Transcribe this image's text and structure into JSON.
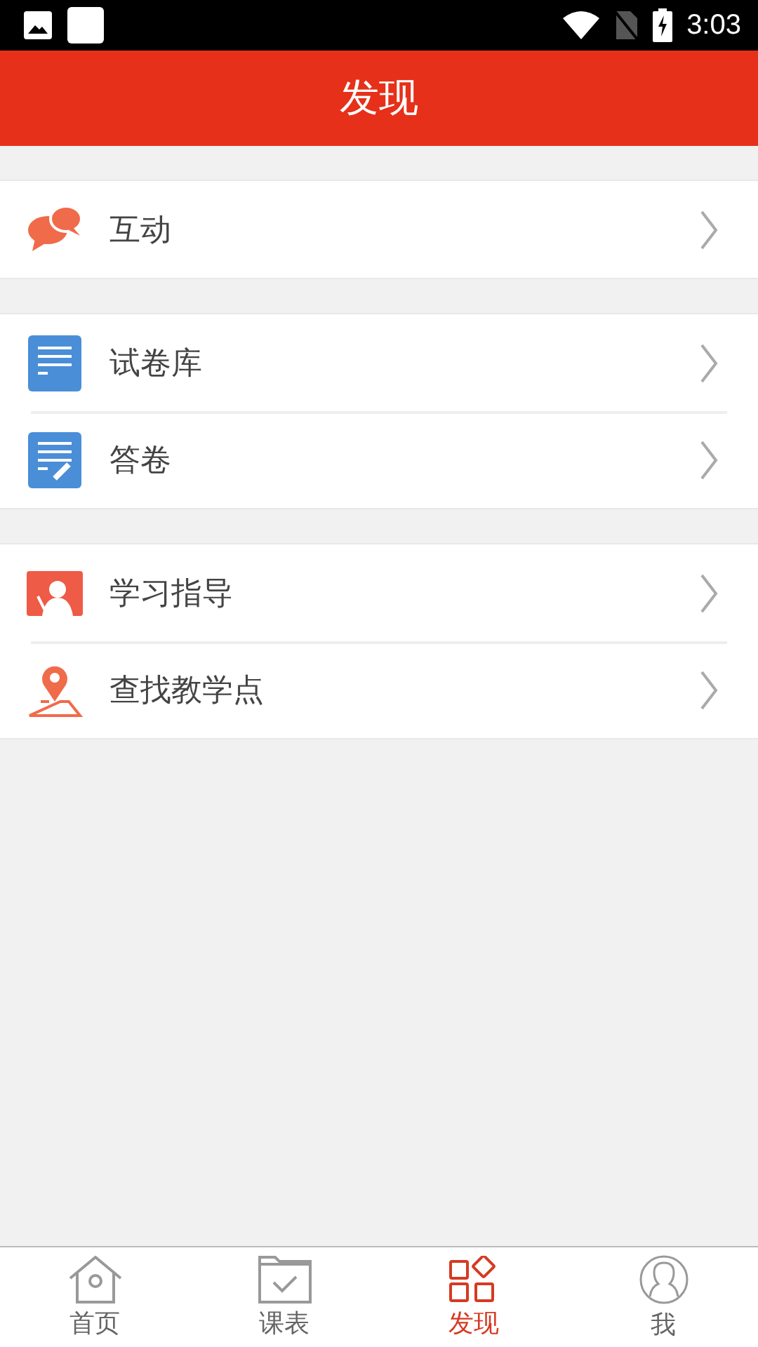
{
  "status_bar": {
    "time": "3:03"
  },
  "header": {
    "title": "发现"
  },
  "sections": [
    {
      "items": [
        {
          "label": "互动",
          "kind": "chat"
        }
      ]
    },
    {
      "items": [
        {
          "label": "试卷库",
          "kind": "doc"
        },
        {
          "label": "答卷",
          "kind": "edit"
        }
      ]
    },
    {
      "items": [
        {
          "label": "学习指导",
          "kind": "teacher"
        },
        {
          "label": "查找教学点",
          "kind": "pin"
        }
      ]
    }
  ],
  "tabs": [
    {
      "label": "首页",
      "kind": "home",
      "selected": false
    },
    {
      "label": "课表",
      "kind": "folder",
      "selected": false
    },
    {
      "label": "发现",
      "kind": "grid",
      "selected": true
    },
    {
      "label": "我",
      "kind": "user",
      "selected": false
    }
  ]
}
